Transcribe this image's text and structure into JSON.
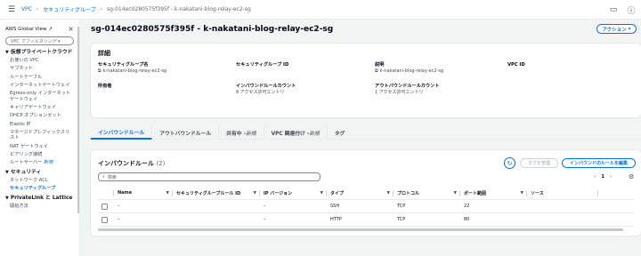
{
  "breadcrumb": {
    "vpc": "VPC",
    "sg": "セキュリティグループ",
    "current": "sg-014ec0280575f395f - k-nakatani-blog-relay-ec2-sg"
  },
  "sidebar": {
    "global_view": "AWS Global View",
    "filter_placeholder": "VPC でフィルタリング",
    "sections": [
      {
        "title": "仮想プライベートクラウド",
        "items": [
          "お使いの VPC",
          "サブネット",
          "ルートテーブル",
          "インターネットゲートウェイ",
          "Egress-only インターネットゲートウェイ",
          "キャリアゲートウェイ",
          "DHCP オプションセット",
          "Elastic IP",
          "マネージドプレフィックスリスト",
          "NAT ゲートウェイ",
          "ピアリング接続",
          "ルートサーバー"
        ]
      },
      {
        "title": "セキュリティ",
        "items": [
          "ネットワーク ACL",
          "セキュリティグループ"
        ]
      },
      {
        "title": "PrivateLink と Lattice",
        "items": [
          "開始方法"
        ]
      }
    ],
    "new_badge": "新規"
  },
  "page": {
    "title": "sg-014ec0280575f395f - k-nakatani-blog-relay-ec2-sg",
    "action": "アクション"
  },
  "details": {
    "heading": "詳細",
    "fields": [
      {
        "k": "セキュリティグループ名",
        "v": "k-nakatani-blog-relay-ec2-sg",
        "copy": true
      },
      {
        "k": "セキュリティグループ ID",
        "v": "",
        "copy": false
      },
      {
        "k": "説明",
        "v": "k-nakatani-blog-relay-ec2-sg",
        "copy": true
      },
      {
        "k": "VPC ID",
        "v": "",
        "copy": false
      },
      {
        "k": "所有者",
        "v": "",
        "copy": false
      },
      {
        "k": "インバウンドルールカウント",
        "v": "8 アクセス許可エントリ",
        "copy": false
      },
      {
        "k": "アウトバウンドルールカウント",
        "v": "1 アクセス許可エントリ",
        "copy": false
      }
    ]
  },
  "tabs": {
    "inbound": "インバウンドルール",
    "outbound": "アウトバウンドルール",
    "sharing": "共有中 - ",
    "vpc_assoc": "VPC 関連付け - ",
    "tags": "タグ",
    "new": "新規"
  },
  "rules": {
    "title": "インバウンドルール",
    "count": "(2)",
    "manage_tags": "タグを管理",
    "edit": "インバウンドのルールを編集",
    "search_placeholder": "検索",
    "page": "1",
    "columns": [
      "Name",
      "セキュリティグループルール ID",
      "IP バージョン",
      "タイプ",
      "プロトコル",
      "ポート範囲",
      "ソース"
    ],
    "rows": [
      {
        "name": "–",
        "rule_id": "",
        "ipver": "–",
        "type": "SSH",
        "protocol": "TCP",
        "port": "22",
        "source": ""
      },
      {
        "name": "–",
        "rule_id": "",
        "ipver": "–",
        "type": "HTTP",
        "protocol": "TCP",
        "port": "80",
        "source": ""
      }
    ]
  }
}
